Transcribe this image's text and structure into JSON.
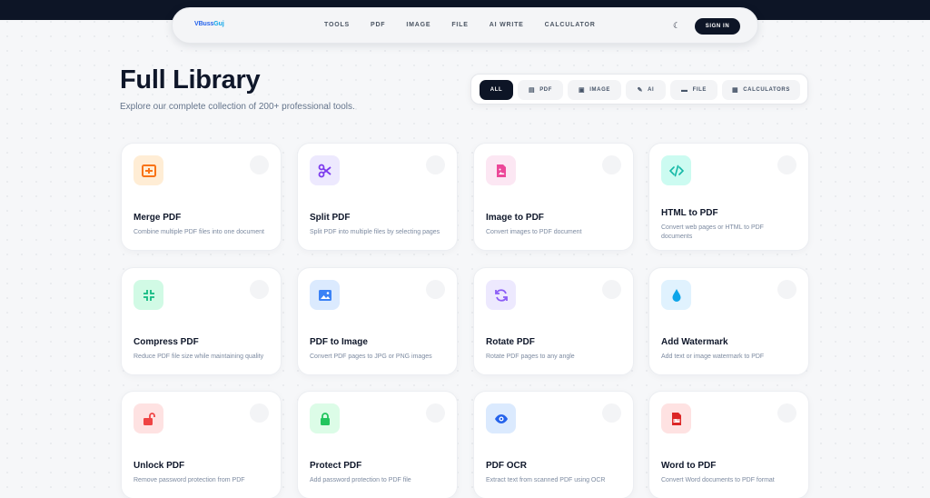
{
  "brand": {
    "name_main": "VBuss",
    "name_accent": "Guj"
  },
  "nav": {
    "links": [
      "TOOLS",
      "PDF",
      "IMAGE",
      "FILE",
      "AI WRITE",
      "CALCULATOR"
    ],
    "signin_label": "SIGN IN"
  },
  "hero": {
    "title": "Full Library",
    "subtitle": "Explore our complete collection of 200+ professional tools."
  },
  "filters": [
    {
      "label": "ALL",
      "icon": "none",
      "active": true
    },
    {
      "label": "PDF",
      "icon": "document-icon",
      "active": false
    },
    {
      "label": "IMAGE",
      "icon": "image-icon",
      "active": false
    },
    {
      "label": "AI",
      "icon": "magic-icon",
      "active": false
    },
    {
      "label": "FILE",
      "icon": "folder-icon",
      "active": false
    },
    {
      "label": "CALCULATORS",
      "icon": "calculator-icon",
      "active": false
    }
  ],
  "tools": [
    {
      "title": "Merge PDF",
      "desc": "Combine multiple PDF files into one document",
      "icon": "merge-icon",
      "color": "#f97316",
      "bg": "#ffedd5"
    },
    {
      "title": "Split PDF",
      "desc": "Split PDF into multiple files by selecting pages",
      "icon": "scissors-icon",
      "color": "#7c3aed",
      "bg": "#ede9fe"
    },
    {
      "title": "Image to PDF",
      "desc": "Convert images to PDF document",
      "icon": "image-file-icon",
      "color": "#ec4899",
      "bg": "#fce7f3"
    },
    {
      "title": "HTML to PDF",
      "desc": "Convert web pages or HTML to PDF documents",
      "icon": "code-icon",
      "color": "#14b8a6",
      "bg": "#ccfbf1"
    },
    {
      "title": "Compress PDF",
      "desc": "Reduce PDF file size while maintaining quality",
      "icon": "compress-icon",
      "color": "#10b981",
      "bg": "#d1fae5"
    },
    {
      "title": "PDF to Image",
      "desc": "Convert PDF pages to JPG or PNG images",
      "icon": "picture-icon",
      "color": "#3b82f6",
      "bg": "#dbeafe"
    },
    {
      "title": "Rotate PDF",
      "desc": "Rotate PDF pages to any angle",
      "icon": "rotate-icon",
      "color": "#8b5cf6",
      "bg": "#ede9fe"
    },
    {
      "title": "Add Watermark",
      "desc": "Add text or image watermark to PDF",
      "icon": "droplet-icon",
      "color": "#0ea5e9",
      "bg": "#e0f2fe"
    },
    {
      "title": "Unlock PDF",
      "desc": "Remove password protection from PDF",
      "icon": "unlock-icon",
      "color": "#ef4444",
      "bg": "#fee2e2"
    },
    {
      "title": "Protect PDF",
      "desc": "Add password protection to PDF file",
      "icon": "lock-icon",
      "color": "#22c55e",
      "bg": "#dcfce7"
    },
    {
      "title": "PDF OCR",
      "desc": "Extract text from scanned PDF using OCR",
      "icon": "eye-icon",
      "color": "#2563eb",
      "bg": "#dbeafe"
    },
    {
      "title": "Word to PDF",
      "desc": "Convert Word documents to PDF format",
      "icon": "pdf-file-icon",
      "color": "#dc2626",
      "bg": "#fee2e2"
    }
  ]
}
